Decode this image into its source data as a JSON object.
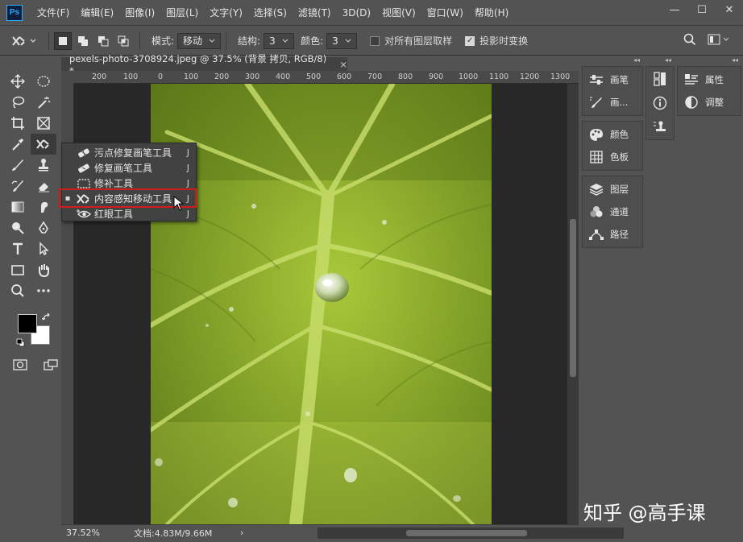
{
  "menubar": {
    "logo": "Ps",
    "items": [
      "文件(F)",
      "编辑(E)",
      "图像(I)",
      "图层(L)",
      "文字(Y)",
      "选择(S)",
      "滤镜(T)",
      "3D(D)",
      "视图(V)",
      "窗口(W)",
      "帮助(H)"
    ],
    "minimize": "—",
    "maximize": "☐",
    "close": "✕"
  },
  "optbar": {
    "mode_label": "模式:",
    "mode_value": "移动",
    "structure_label": "结构:",
    "structure_value": "3",
    "color_label": "颜色:",
    "color_value": "3",
    "sample_all_label": "对所有图层取样",
    "sample_all_checked": false,
    "transform_label": "投影时变换",
    "transform_checked": true
  },
  "document": {
    "tab_title": "pexels-photo-3708924.jpeg @ 37.5% (背景 拷贝, RGB/8) *",
    "tab_close": "×",
    "ruler_labels": [
      "200",
      "100",
      "0",
      "100",
      "200",
      "300",
      "400",
      "500",
      "600",
      "700",
      "800",
      "900",
      "1000",
      "1100",
      "1200",
      "1300"
    ]
  },
  "flyout": {
    "items": [
      {
        "label": "污点修复画笔工具",
        "shortcut": "J",
        "icon": "spot-healing-icon",
        "selected": false
      },
      {
        "label": "修复画笔工具",
        "shortcut": "J",
        "icon": "healing-brush-icon",
        "selected": false
      },
      {
        "label": "修补工具",
        "shortcut": "J",
        "icon": "patch-icon",
        "selected": false
      },
      {
        "label": "内容感知移动工具",
        "shortcut": "J",
        "icon": "content-aware-move-icon",
        "selected": true
      },
      {
        "label": "红眼工具",
        "shortcut": "J",
        "icon": "red-eye-icon",
        "selected": false
      }
    ]
  },
  "status": {
    "zoom": "37.52%",
    "doc_info": "文档:4.83M/9.66M",
    "arrow": "›"
  },
  "panels": {
    "col1": [
      {
        "label": "画笔",
        "icon": "brush-settings-icon"
      },
      {
        "label": "画...",
        "icon": "brush-presets-icon"
      },
      {
        "label": "颜色",
        "icon": "color-palette-icon"
      },
      {
        "label": "色板",
        "icon": "swatches-icon"
      },
      {
        "label": "图层",
        "icon": "layers-icon"
      },
      {
        "label": "通道",
        "icon": "channels-icon"
      },
      {
        "label": "路径",
        "icon": "paths-icon"
      }
    ],
    "col3": [
      {
        "label": "属性",
        "icon": "properties-icon"
      },
      {
        "label": "调整",
        "icon": "adjustments-icon"
      }
    ]
  },
  "watermark": "知乎 @高手课",
  "colors": {
    "accent_red": "#d21b1b",
    "ps_blue": "#31a8ff"
  }
}
